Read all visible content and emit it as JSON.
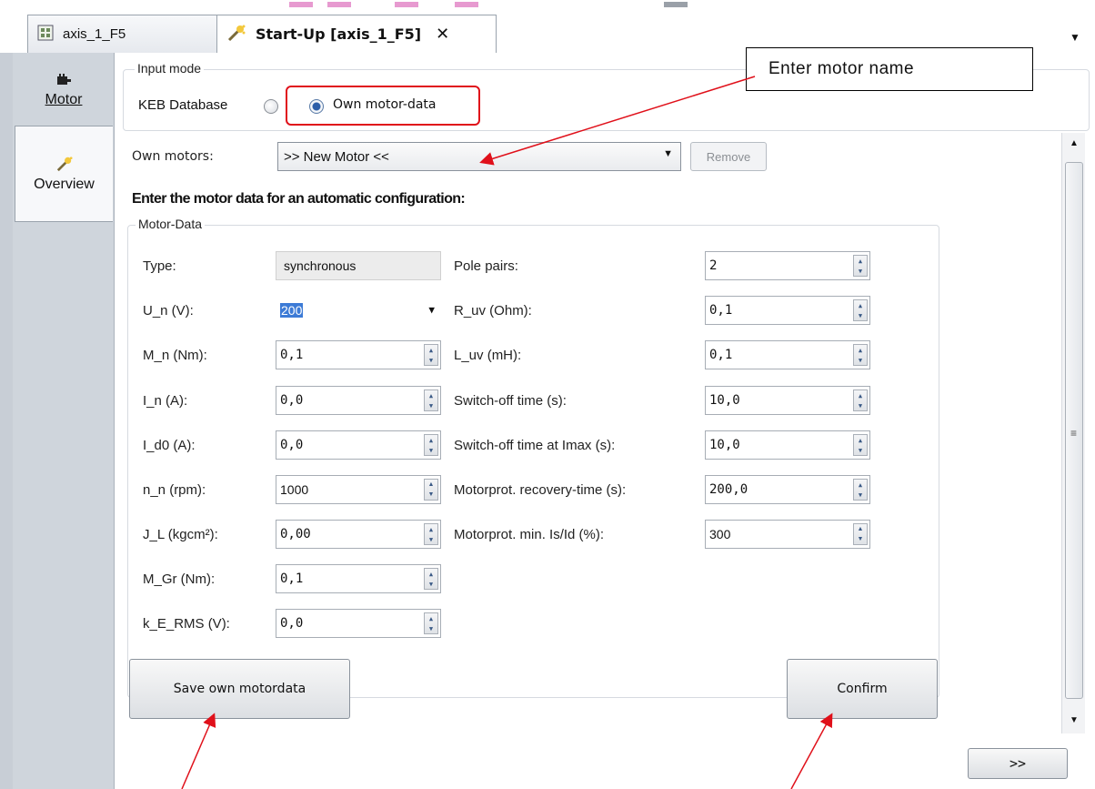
{
  "tabs": [
    {
      "label": "axis_1_F5",
      "icon": "grid-icon",
      "active": false
    },
    {
      "label": "Start-Up [axis_1_F5]",
      "icon": "wand-icon",
      "active": true,
      "close": "✕"
    }
  ],
  "tabbar_menu_icon": "▼",
  "sidebar": {
    "items": [
      {
        "label": "Motor",
        "icon": "motor-icon"
      },
      {
        "label": "Overview",
        "icon": "wand-icon"
      }
    ]
  },
  "input_mode": {
    "legend": "Input mode",
    "options": [
      {
        "label": "KEB Database",
        "selected": false
      },
      {
        "label": "Own motor-data",
        "selected": true
      }
    ]
  },
  "own_motors": {
    "label": "Own motors:",
    "selected": ">> New Motor <<",
    "remove_label": "Remove"
  },
  "heading": "Enter the motor data for an automatic configuration:",
  "motor_data": {
    "legend": "Motor-Data",
    "left_fields": [
      {
        "label": "Type:",
        "value": "synchronous",
        "kind": "readonly"
      },
      {
        "label": "U_n (V):",
        "value": "200",
        "kind": "combo"
      },
      {
        "label": "M_n (Nm):",
        "value": "0,1",
        "kind": "spin"
      },
      {
        "label": "I_n (A):",
        "value": "0,0",
        "kind": "spin"
      },
      {
        "label": "I_d0 (A):",
        "value": "0,0",
        "kind": "spin"
      },
      {
        "label": "n_n (rpm):",
        "value": "1000",
        "kind": "spin"
      },
      {
        "label": "J_L (kgcm²):",
        "value": "0,00",
        "kind": "spin"
      },
      {
        "label": "M_Gr (Nm):",
        "value": "0,1",
        "kind": "spin"
      },
      {
        "label": "k_E_RMS (V):",
        "value": "0,0",
        "kind": "spin"
      }
    ],
    "right_fields": [
      {
        "label": "Pole pairs:",
        "value": "2"
      },
      {
        "label": "R_uv (Ohm):",
        "value": "0,1"
      },
      {
        "label": "L_uv (mH):",
        "value": "0,1"
      },
      {
        "label": "Switch-off time (s):",
        "value": "10,0"
      },
      {
        "label": "Switch-off time at Imax (s):",
        "value": "10,0"
      },
      {
        "label": "Motorprot. recovery-time (s):",
        "value": "200,0"
      },
      {
        "label": "Motorprot. min. Is/Id (%):",
        "value": "300"
      }
    ]
  },
  "buttons": {
    "save": "Save own motordata",
    "confirm": "Confirm",
    "next": ">>"
  },
  "annotation": {
    "callout": "Enter motor name",
    "color": "#e0101a"
  }
}
